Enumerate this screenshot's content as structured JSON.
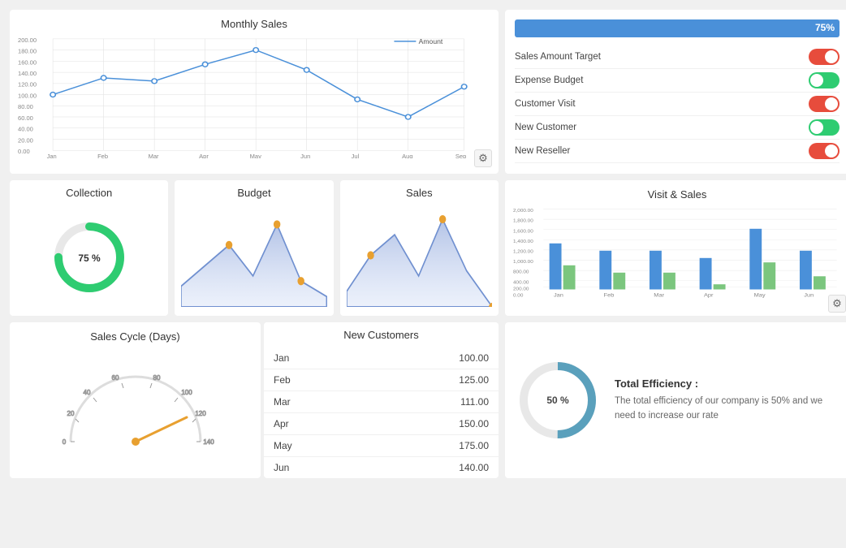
{
  "monthly_sales": {
    "title": "Monthly Sales",
    "legend": "Amount",
    "y_axis": [
      "200.00",
      "180.00",
      "160.00",
      "140.00",
      "120.00",
      "100.00",
      "80.00",
      "60.00",
      "40.00",
      "20.00",
      "0.00"
    ],
    "x_axis": [
      "Jan",
      "Feb",
      "Mar",
      "Apr",
      "May",
      "Jun",
      "Jul",
      "Aug",
      "Sep"
    ],
    "data": [
      100,
      130,
      125,
      155,
      180,
      145,
      90,
      60,
      115
    ]
  },
  "progress": {
    "value": 75,
    "label": "75%"
  },
  "toggles": [
    {
      "label": "Sales Amount Target",
      "state": "on"
    },
    {
      "label": "Expense Budget",
      "state": "green"
    },
    {
      "label": "Customer Visit",
      "state": "on"
    },
    {
      "label": "New Customer",
      "state": "green"
    },
    {
      "label": "New Reseller",
      "state": "on"
    }
  ],
  "collection": {
    "title": "Collection",
    "value": 75,
    "label": "75 %"
  },
  "budget": {
    "title": "Budget"
  },
  "sales_mini": {
    "title": "Sales"
  },
  "visit_sales": {
    "title": "Visit & Sales",
    "x_axis": [
      "Jan",
      "Feb",
      "Mar",
      "Apr",
      "May",
      "Jun"
    ],
    "blue_data": [
      1100,
      1000,
      1000,
      900,
      1600,
      1000
    ],
    "green_data": [
      600,
      400,
      400,
      200,
      600,
      350
    ]
  },
  "sales_cycle": {
    "title": "Sales Cycle (Days)",
    "value": 120,
    "ticks": [
      "0",
      "20",
      "40",
      "60",
      "80",
      "100",
      "120",
      "140"
    ]
  },
  "new_customers": {
    "title": "New Customers",
    "rows": [
      {
        "month": "Jan",
        "value": "100.00"
      },
      {
        "month": "Feb",
        "value": "125.00"
      },
      {
        "month": "Mar",
        "value": "111.00"
      },
      {
        "month": "Apr",
        "value": "150.00"
      },
      {
        "month": "May",
        "value": "175.00"
      },
      {
        "month": "Jun",
        "value": "140.00"
      }
    ]
  },
  "total_efficiency": {
    "title": "Total Efficiency :",
    "value": 50,
    "label": "50 %",
    "description": "The total efficiency of our company is 50% and we need to increase our rate"
  }
}
